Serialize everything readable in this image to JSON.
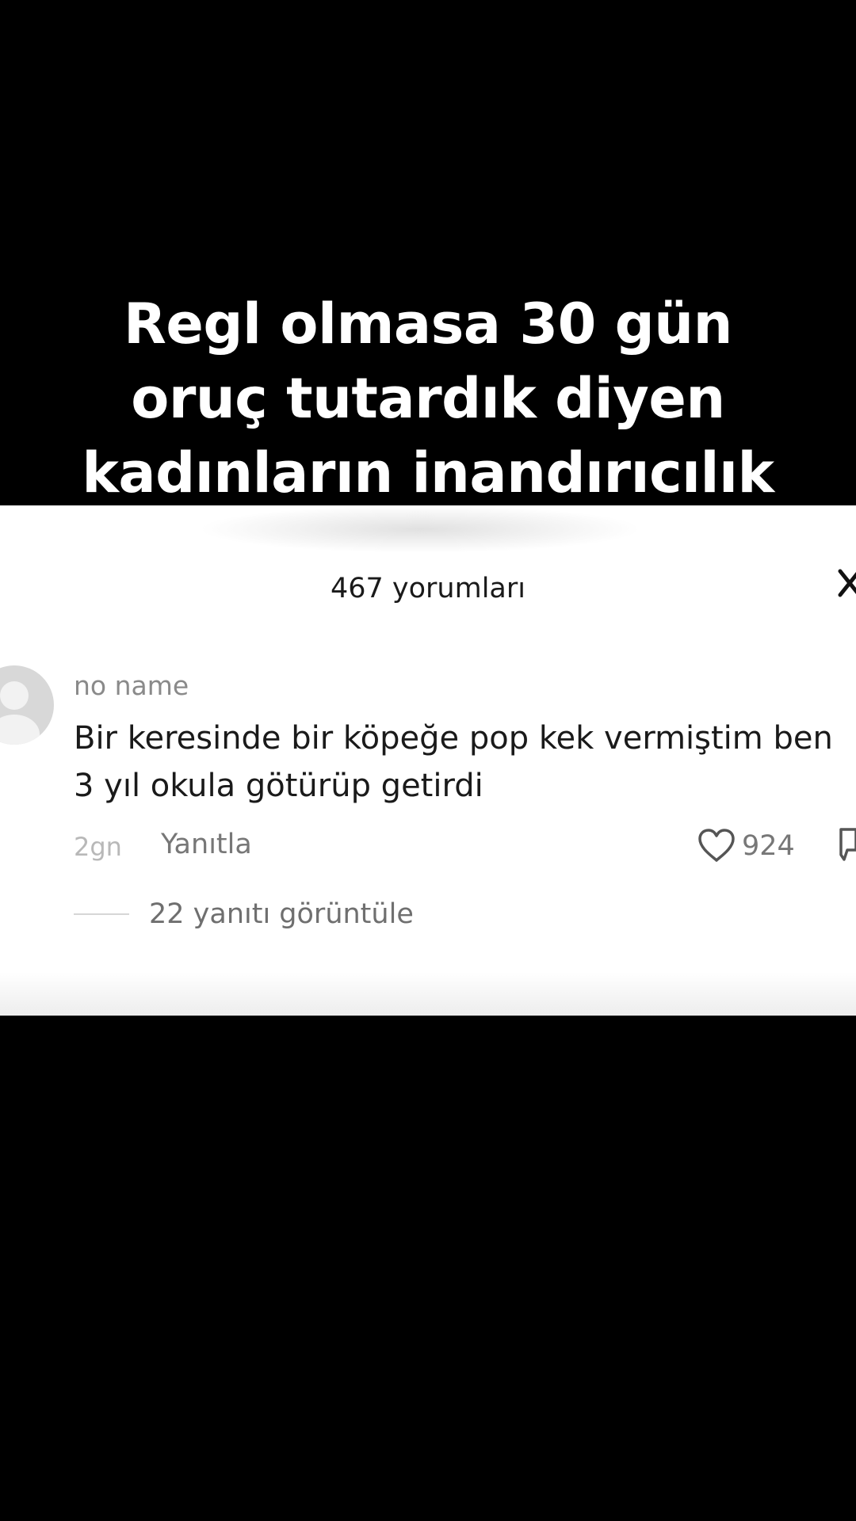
{
  "overlay_caption": {
    "lines": [
      "Regl olmasa 30 gün",
      "oruç tutardık diyen",
      "kadınların inandırıcılık"
    ]
  },
  "comments_panel": {
    "header": "467 yorumları",
    "close_icon": "close-icon"
  },
  "comment": {
    "avatar_icon": "default-avatar-icon",
    "username": "no name",
    "text_lines": [
      "Bir keresinde bir köpeğe pop kek vermiştim ben",
      "3 yıl okula götürüp getirdi"
    ],
    "time_ago": "2gn",
    "reply_label": "Yanıtla",
    "like_icon": "heart-icon",
    "like_count": "924",
    "dislike_icon": "dislike-icon",
    "view_replies": "22 yanıtı görüntüle"
  },
  "colors": {
    "background": "#000000",
    "caption_text": "#ffffff",
    "panel_background": "#ffffff",
    "primary_text": "#1a1a1a",
    "secondary_text": "#777777"
  }
}
